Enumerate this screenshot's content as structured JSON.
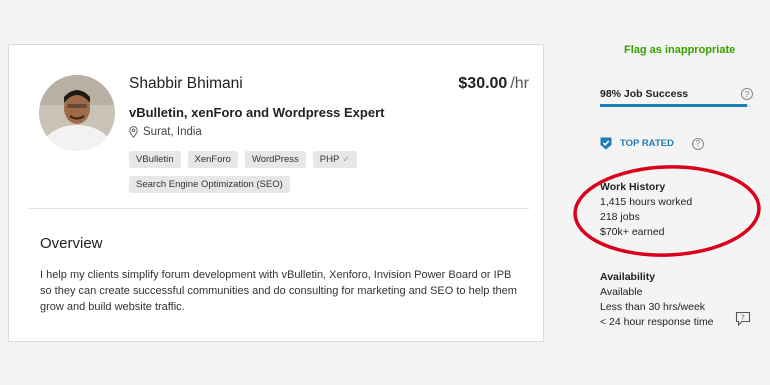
{
  "profile": {
    "name": "Shabbir Bhimani",
    "rate": "$30.00",
    "rate_unit": "/hr",
    "title": "vBulletin, xenForo and Wordpress Expert",
    "location": "Surat, India",
    "tags": [
      "VBulletin",
      "XenForo",
      "WordPress",
      "PHP",
      "Search Engine Optimization (SEO)"
    ],
    "verified_tag_mark": "✓"
  },
  "overview": {
    "heading": "Overview",
    "text_lines": [
      "I help my clients simplify forum development with vBulletin, Xenforo, Invision Power Board or IPB",
      "so they can create successful communities and do consulting for marketing and SEO to help them",
      "grow and build website traffic."
    ]
  },
  "sidebar": {
    "flag_link": "Flag as inappropriate",
    "job_success": "98% Job Success",
    "job_success_value": 0.98,
    "help_glyph": "?",
    "top_rated": "TOP RATED",
    "work_history": {
      "heading": "Work History",
      "hours": "1,415 hours worked",
      "jobs": "218 jobs",
      "earned": "$70k+ earned"
    },
    "availability": {
      "heading": "Availability",
      "status": "Available",
      "hours": "Less than 30 hrs/week",
      "response": "< 24 hour response time"
    }
  },
  "colors": {
    "accent_green": "#37a000",
    "accent_blue": "#1d7eb5",
    "highlight_red": "#d9001b"
  },
  "icons": [
    "location-pin-icon",
    "help-icon",
    "top-rated-badge-icon",
    "chat-icon",
    "verified-check-icon"
  ]
}
